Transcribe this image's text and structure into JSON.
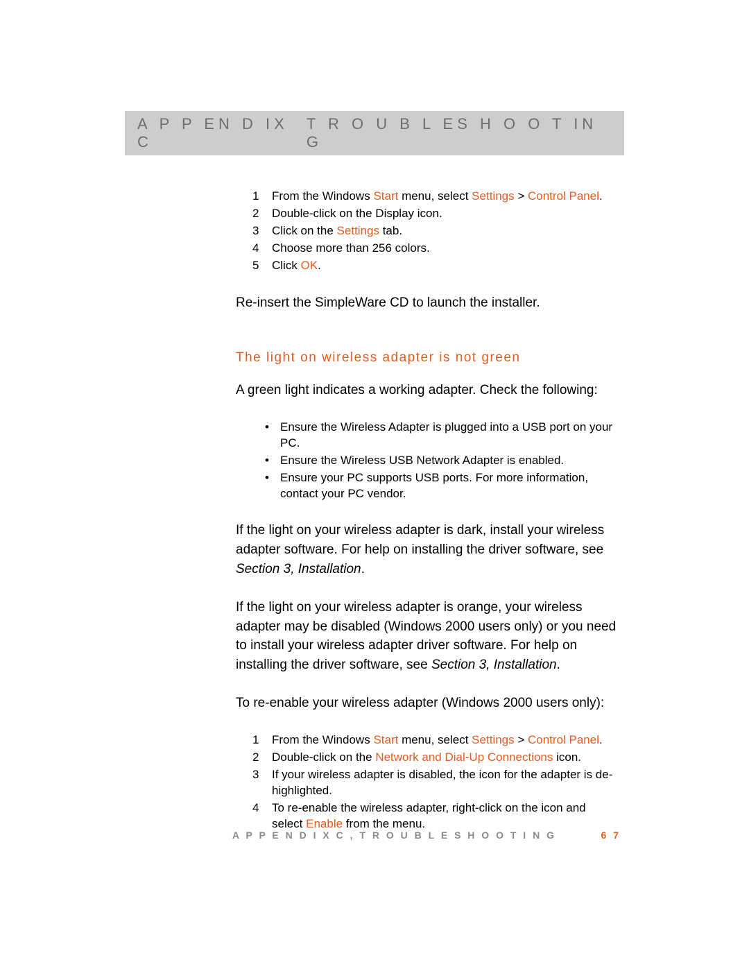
{
  "header": {
    "left": "A P P EN D IX  C",
    "right": "T R O U B L ES H O O T IN G"
  },
  "steps1": {
    "s1_pre": "From the Windows ",
    "s1_start": "Start",
    "s1_mid": " menu, select ",
    "s1_settings": "Settings",
    "s1_gt": " > ",
    "s1_cp": "Control Panel",
    "s1_dot": ".",
    "s2": "Double-click on the Display icon.",
    "s3_pre": "Click on the ",
    "s3_set": "Settings",
    "s3_post": " tab.",
    "s4": "Choose more than 256 colors.",
    "s5_pre": "Click ",
    "s5_ok": "OK",
    "s5_dot": "."
  },
  "p_reinsert": "Re-insert the SimpleWare CD to launch the installer.",
  "heading_light": "The light on wireless adapter is not green",
  "p_green": "A green light indicates a working adapter. Check the following:",
  "bullets": {
    "b1": "Ensure the Wireless Adapter is plugged into a USB port on your PC.",
    "b2": "Ensure the Wireless USB Network Adapter is enabled.",
    "b3": "Ensure your PC supports USB ports.  For more information, contact your PC vendor."
  },
  "p_dark_a": "If the light on your wireless adapter is dark, install your wireless adapter software.  For help on installing the driver software, see ",
  "p_dark_ref": "Section 3, Installation",
  "p_dark_dot": ".",
  "p_orange_a": "If the light on your wireless adapter is orange, your wireless adapter may be disabled (Windows 2000 users only) or you need to install your wireless adapter driver software.  For help on installing the driver software, see ",
  "p_orange_ref": "Section 3, Installation",
  "p_orange_dot": ".",
  "p_reenable": "To re-enable your wireless adapter (Windows 2000 users only):",
  "steps2": {
    "s1_pre": "From the Windows ",
    "s1_start": "Start",
    "s1_mid": " menu, select ",
    "s1_settings": "Settings",
    "s1_gt": " > ",
    "s1_cp": "Control Panel",
    "s1_dot": ".",
    "s2_pre": "Double-click on the ",
    "s2_net": "Network and Dial-Up Connections",
    "s2_post": " icon.",
    "s3": "If your wireless adapter is disabled, the icon for the adapter is de-highlighted.",
    "s4_pre": "To re-enable the wireless adapter, right-click on the icon and select ",
    "s4_en": "Enable",
    "s4_post": " from the menu."
  },
  "footer": {
    "text": "A P P E N D I X  C ,  T R O U B L E S H O O T I N G",
    "page": "6 7"
  }
}
